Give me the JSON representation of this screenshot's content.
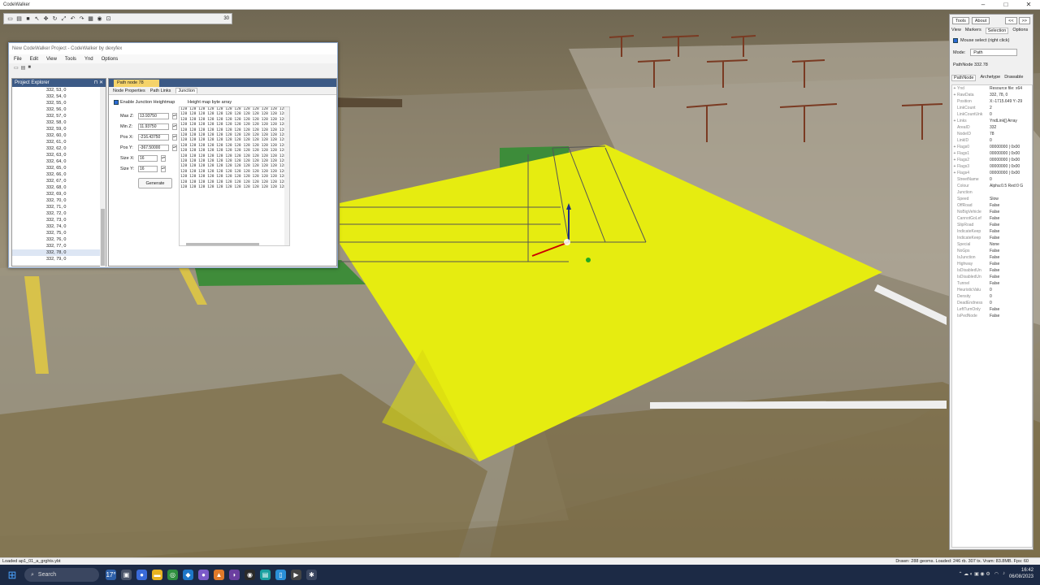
{
  "window": {
    "title": "CodeWalker"
  },
  "toolbar": {
    "zoom": "30"
  },
  "project": {
    "title": "New CodeWalker Project - CodeWalker by dexyfex",
    "menu": [
      "File",
      "Edit",
      "View",
      "Tools",
      "Ynd",
      "Options"
    ],
    "explorer": {
      "title": "Project Explorer",
      "items": [
        "332, 53, 0",
        "332, 54, 0",
        "332, 55, 0",
        "332, 56, 0",
        "332, 57, 0",
        "332, 58, 0",
        "332, 59, 0",
        "332, 60, 0",
        "332, 61, 0",
        "332, 62, 0",
        "332, 63, 0",
        "332, 64, 0",
        "332, 65, 0",
        "332, 66, 0",
        "332, 67, 0",
        "332, 68, 0",
        "332, 69, 0",
        "332, 70, 0",
        "332, 71, 0",
        "332, 72, 0",
        "332, 73, 0",
        "332, 74, 0",
        "332, 75, 0",
        "332, 76, 0",
        "332, 77, 0",
        "332, 78, 0",
        "332, 79, 0"
      ]
    },
    "doc_tab": "Path node 78",
    "subtabs": [
      "Node Properties",
      "Path Links",
      "Junction"
    ],
    "junction": {
      "enable_label": "Enable Junction Heightmap",
      "heightmap_label": "Height map byte array",
      "fields": [
        {
          "label": "Max Z:",
          "value": "13.93750"
        },
        {
          "label": "Min Z:",
          "value": "11.93750"
        },
        {
          "label": "Pos X:",
          "value": "-216.43750"
        },
        {
          "label": "Pos Y:",
          "value": "-367.50000"
        },
        {
          "label": "Size X:",
          "value": "16"
        },
        {
          "label": "Size Y:",
          "value": "16"
        }
      ],
      "generate": "Generate",
      "heightmap_row": "128 128 128 128 128 128 128 128 128 128 128 128 128 128 128 128"
    }
  },
  "right_panel": {
    "top_buttons": [
      "Tools",
      "About"
    ],
    "nav": [
      "<<",
      ">>"
    ],
    "tabs": [
      "View",
      "Markers",
      "Selection",
      "Options"
    ],
    "mouse_select": "Mouse select (right click)",
    "mode_label": "Mode:",
    "mode_value": "Path",
    "pathnode": "PathNode 332.78",
    "sub_tabs": [
      "PathNode",
      "Archetype",
      "Drawable"
    ],
    "props": [
      [
        "+",
        "Ynd",
        "Resource file: x64"
      ],
      [
        "+",
        "RawData",
        "332, 78, 0"
      ],
      [
        "",
        "Position",
        "X:-1715.649 Y:-29"
      ],
      [
        "",
        "LinkCount",
        "2"
      ],
      [
        "",
        "LinkCountUnk",
        "0"
      ],
      [
        "+",
        "Links",
        "YndLink[] Array"
      ],
      [
        "",
        "AreaID",
        "332"
      ],
      [
        "",
        "NodeID",
        "78"
      ],
      [
        "",
        "LinkID",
        "0"
      ],
      [
        "+",
        "Flags0",
        "00000000 | 0x00"
      ],
      [
        "+",
        "Flags1",
        "00000000 | 0x00"
      ],
      [
        "+",
        "Flags2",
        "00000000 | 0x00"
      ],
      [
        "+",
        "Flags3",
        "00000000 | 0x00"
      ],
      [
        "+",
        "Flags4",
        "00000000 | 0x00"
      ],
      [
        "",
        "StreetName",
        "0"
      ],
      [
        "",
        "Colour",
        "Alpha:0.5 Red:0 G"
      ],
      [
        "",
        "Junction",
        ""
      ],
      [
        "",
        "Speed",
        "Slow"
      ],
      [
        "",
        "OffRoad",
        "False"
      ],
      [
        "",
        "NoBigVehicle",
        "False"
      ],
      [
        "",
        "CannotGoLef",
        "False"
      ],
      [
        "",
        "SlipRoad",
        "False"
      ],
      [
        "",
        "IndicateKeep",
        "False"
      ],
      [
        "",
        "IndicateKeep",
        "False"
      ],
      [
        "",
        "Special",
        "None"
      ],
      [
        "",
        "NoGps",
        "False"
      ],
      [
        "",
        "IsJunction",
        "False"
      ],
      [
        "",
        "Highway",
        "False"
      ],
      [
        "",
        "IsDisabledUn",
        "False"
      ],
      [
        "",
        "IsDisabledUn",
        "False"
      ],
      [
        "",
        "Tunnel",
        "False"
      ],
      [
        "",
        "HeuristicValu",
        "0"
      ],
      [
        "",
        "Density",
        "0"
      ],
      [
        "",
        "DeadEndness",
        "0"
      ],
      [
        "",
        "LeftTurnOnly",
        "False"
      ],
      [
        "",
        "IsPedNode",
        "False"
      ]
    ]
  },
  "status": {
    "left": "Loaded ap1_01_a_grghts.ybt",
    "right": "Drawn: 288 geoms. Loaded: 246 rb. 307 tx. Vram: 83.8MB. Fps: 60"
  },
  "taskbar": {
    "search": "Search",
    "temp": "17°",
    "time": "16:42",
    "date": "06/08/2023"
  }
}
